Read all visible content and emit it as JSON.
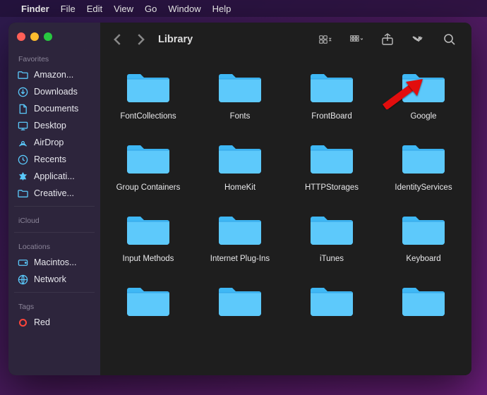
{
  "menubar": {
    "app": "Finder",
    "items": [
      "File",
      "Edit",
      "View",
      "Go",
      "Window",
      "Help"
    ]
  },
  "window": {
    "location": "Library"
  },
  "sidebar": {
    "sections": [
      {
        "label": "Favorites",
        "items": [
          {
            "icon": "folder",
            "label": "Amazon..."
          },
          {
            "icon": "download",
            "label": "Downloads"
          },
          {
            "icon": "document",
            "label": "Documents"
          },
          {
            "icon": "desktop",
            "label": "Desktop"
          },
          {
            "icon": "airdrop",
            "label": "AirDrop"
          },
          {
            "icon": "clock",
            "label": "Recents"
          },
          {
            "icon": "app",
            "label": "Applicati..."
          },
          {
            "icon": "folder",
            "label": "Creative..."
          }
        ]
      },
      {
        "label": "iCloud",
        "items": []
      },
      {
        "label": "Locations",
        "items": [
          {
            "icon": "disk",
            "label": "Macintos..."
          },
          {
            "icon": "globe",
            "label": "Network"
          }
        ]
      },
      {
        "label": "Tags",
        "items": [
          {
            "icon": "tag",
            "label": "Red",
            "color": "#ff453a"
          }
        ]
      }
    ]
  },
  "folders": [
    "FontCollections",
    "Fonts",
    "FrontBoard",
    "Google",
    "Group Containers",
    "HomeKit",
    "HTTPStorages",
    "IdentityServices",
    "Input Methods",
    "Internet Plug-Ins",
    "iTunes",
    "Keyboard",
    "",
    "",
    "",
    ""
  ],
  "annotation": {
    "target": "Google"
  }
}
